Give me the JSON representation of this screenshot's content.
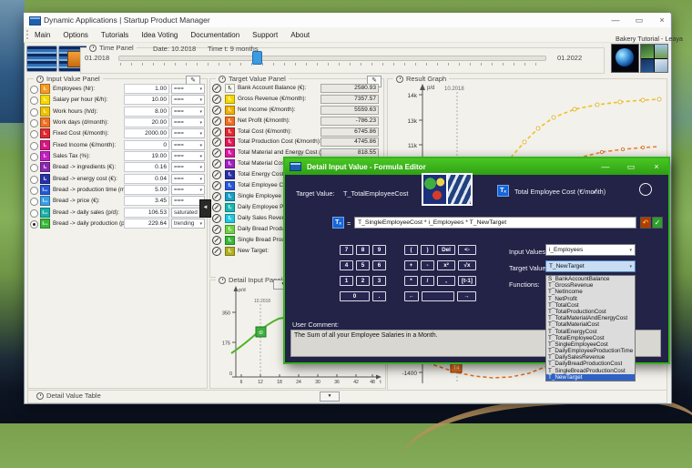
{
  "icons": {
    "minimize": "—",
    "maximize": "▭",
    "close": "×",
    "collapse": "▼",
    "splitter": "◄",
    "chevron": "▾",
    "check": "✓",
    "undo": "↶",
    "edit": "✎",
    "dlg_min": "—",
    "dlg_max": "▭",
    "dlg_close": "×"
  },
  "window": {
    "title": "Dynamic Applications | Startup Product Manager",
    "menu": [
      "Main",
      "Options",
      "Tutorials",
      "Idea Voting",
      "Documentation",
      "Support",
      "About"
    ],
    "session": "Bakery Tutorial - Leaya"
  },
  "time_panel": {
    "title": "Time Panel",
    "date_label": "Date:  10.2018",
    "time_label": "Time t:   9 months",
    "range_start": "01.2018",
    "range_end": "01.2022"
  },
  "input_panel": {
    "title": "Input Value Panel",
    "rows": [
      {
        "id": "I₁",
        "label": "Employees (Nr):",
        "value": "1.00",
        "mode": "===",
        "color": "#f59a23"
      },
      {
        "id": "I₂",
        "label": "Salary per hour (€/h):",
        "value": "10.00",
        "mode": "===",
        "color": "#f5d800"
      },
      {
        "id": "I₃",
        "label": "Work hours (h/d):",
        "value": "8.00",
        "mode": "===",
        "color": "#eec200"
      },
      {
        "id": "I₄",
        "label": "Work days (d/month):",
        "value": "20.00",
        "mode": "===",
        "color": "#f07020"
      },
      {
        "id": "I₅",
        "label": "Fixed Cost (€/month):",
        "value": "2000.00",
        "mode": "===",
        "color": "#e02830"
      },
      {
        "id": "I₆",
        "label": "Fixed Income (€/month):",
        "value": "0",
        "mode": "===",
        "color": "#d81880"
      },
      {
        "id": "I₇",
        "label": "Sales Tax (%):",
        "value": "19.00",
        "mode": "===",
        "color": "#c020c0"
      },
      {
        "id": "I₈",
        "label": "Bread -> ingredients (€):",
        "value": "0.16",
        "mode": "===",
        "color": "#8828b0"
      },
      {
        "id": "I₉",
        "label": "Bread -> energy cost (€):",
        "value": "0.04",
        "mode": "===",
        "color": "#2830a8"
      },
      {
        "id": "I₁₀",
        "label": "Bread -> production time (min/p):",
        "value": "5.00",
        "mode": "===",
        "color": "#2858d8"
      },
      {
        "id": "I₁₁",
        "label": "Bread -> price (€):",
        "value": "3.45",
        "mode": "===",
        "color": "#38a0e8"
      },
      {
        "id": "I₁₂",
        "label": "Bread -> daily sales (p/d):",
        "value": "106.53",
        "mode": "saturated",
        "color": "#18b0a8",
        "selected": false
      },
      {
        "id": "I₁₃",
        "label": "Bread -> daily production (p/d):",
        "value": "229.64",
        "mode": "trending",
        "color": "#38b838",
        "selected": true
      }
    ]
  },
  "target_panel": {
    "title": "Target Value Panel",
    "rows": [
      {
        "id": "fₓ",
        "label": "Bank Account Balance (€):",
        "value": "2580.93",
        "color": "#f7f7f2"
      },
      {
        "id": "fₓ",
        "label": "Gross Revenue (€/month):",
        "value": "7357.57",
        "color": "#f5d800"
      },
      {
        "id": "fₓ",
        "label": "Net Income (€/month):",
        "value": "5559.63",
        "color": "#f0b000"
      },
      {
        "id": "fₓ",
        "label": "Net Profit (€/month):",
        "value": "-786.23",
        "color": "#f07020"
      },
      {
        "id": "fₓ",
        "label": "Total Cost (€/month):",
        "value": "6745.86",
        "color": "#e02830"
      },
      {
        "id": "fₓ",
        "label": "Total Production Cost (€/month):",
        "value": "4745.86",
        "color": "#e01858"
      },
      {
        "id": "fₓ",
        "label": "Total Material and Energy Cost (€/month):",
        "value": "818.55",
        "color": "#d818a0"
      },
      {
        "id": "fₓ",
        "label": "Total Material Cost (€/month):",
        "value": "",
        "color": "#a020c0"
      },
      {
        "id": "fₓ",
        "label": "Total Energy Cost (€/month):",
        "value": "",
        "color": "#2830a8"
      },
      {
        "id": "fₓ",
        "label": "Total Employee Cost (€/month):",
        "value": "",
        "color": "#2858d8"
      },
      {
        "id": "fₓ",
        "label": "Single Employee Cost (€/month):",
        "value": "",
        "color": "#18a0c8"
      },
      {
        "id": "fₓ",
        "label": "Daily Employee Production Time (h/day):",
        "value": "",
        "color": "#18b8b0"
      },
      {
        "id": "fₓ",
        "label": "Daily Sales Revenue (€/day):",
        "value": "",
        "color": "#20c8e0"
      },
      {
        "id": "fₓ",
        "label": "Daily Bread Production Cost (€/day):",
        "value": "",
        "color": "#70d048"
      },
      {
        "id": "fₓ",
        "label": "Single Bread Production Cost (€):",
        "value": "",
        "color": "#38b838"
      },
      {
        "id": "fₓ",
        "label": "New Target:",
        "value": "",
        "color": "#b0b020"
      }
    ]
  },
  "result_graph": {
    "title": "Result Graph",
    "ylabel": "p/d",
    "time_marker": "10.2018",
    "ytick_14k": "14k",
    "ytick_13k": "13k",
    "ytick_11k": "11k",
    "ytick_neg": "-1400",
    "marker": "T4"
  },
  "detail_panel": {
    "title": "Detail Input Panel",
    "ylabel": "p/d",
    "time_marker": "10.2018",
    "y350": "350",
    "y175": "175",
    "y0": "0",
    "xticks": [
      "6",
      "12",
      "18",
      "24",
      "30",
      "36",
      "42",
      "48"
    ],
    "xlabel": "t",
    "marker": "t0"
  },
  "detail_table": {
    "title": "Detail Value Table"
  },
  "dialog": {
    "title": "Detail Input Value - Formula Editor",
    "target_value_label": "Target Value:",
    "target_value": "T_TotalEmployeeCost",
    "ticon": "Tₓ",
    "target_name": "Total Employee Cost (€/month)",
    "equals": "=",
    "formula": "T_SingleEmployeeCost * i_Employees * T_NewTarget",
    "keys_left": [
      "7",
      "8",
      "9",
      "4",
      "5",
      "6",
      "1",
      "2",
      "3",
      "0",
      "."
    ],
    "keys_right": [
      "(",
      ")",
      "Del",
      "<-",
      "+",
      "-",
      "x²",
      "√x",
      "*",
      "/",
      ",",
      "[t-1]",
      "←",
      "",
      "→"
    ],
    "input_values_label": "Input Values:",
    "input_values_value": "i_Employees",
    "target_values_label": "Target Values:",
    "target_values_value": "T_NewTarget",
    "functions_label": "Functions:",
    "dropdown_items": [
      "S_BankAccountBalance",
      "T_GrossRevenue",
      "T_NetIncome",
      "T_NetProfit",
      "T_TotalCost",
      "T_TotalProductionCost",
      "T_TotalMaterialAndEnergyCost",
      "T_TotalMaterialCost",
      "T_TotalEnergyCost",
      "T_TotalEmployeeCost",
      "T_SingleEmployeeCost",
      "T_DailyEmployeeProductionTime",
      "T_DailySalesRevenue",
      "T_DailyBreadProductionCost",
      "T_SingleBreadProductionCost",
      "T_NewTarget"
    ],
    "user_comment_label": "User Comment:",
    "user_comment": "The Sum of all your Employee Salaries in a Month."
  },
  "chart_data": [
    {
      "type": "line",
      "title": "Result Graph",
      "ylabel": "p/d",
      "yticks": [
        "14k",
        "13k",
        "11k",
        "-1400"
      ],
      "time_marker": "10.2018",
      "series": [
        {
          "name": "saturating-yellow",
          "approx_x_months": [
            14,
            18,
            22,
            26,
            30,
            34,
            38,
            42,
            46
          ],
          "approx_y": [
            10800,
            11800,
            12600,
            13100,
            13500,
            13700,
            13850,
            13950,
            14000
          ]
        },
        {
          "name": "rising-orange",
          "approx_x_months": [
            26,
            30,
            34,
            38,
            42,
            46
          ],
          "approx_y": [
            10700,
            10850,
            10950,
            11000,
            11050,
            11100
          ]
        },
        {
          "name": "net-profit-orange",
          "approx_x_months": [
            2,
            6,
            10,
            14,
            18,
            22,
            26
          ],
          "approx_y": [
            -1200,
            -1320,
            -1400,
            -1420,
            -1380,
            -1280,
            -1150
          ],
          "marker_label": "T4"
        }
      ]
    },
    {
      "type": "line",
      "title": "Detail Input Panel",
      "ylabel": "p/d",
      "yticks": [
        0,
        175,
        350
      ],
      "xticks": [
        6,
        12,
        18,
        24,
        30,
        36,
        42,
        48
      ],
      "time_marker": "10.2018",
      "series": [
        {
          "name": "Bread -> daily production (trending)",
          "approx_x_months": [
            1,
            3,
            6,
            9,
            12,
            16,
            20,
            26
          ],
          "approx_y": [
            120,
            140,
            170,
            230,
            260,
            280,
            290,
            295
          ],
          "marker_label": "t0"
        }
      ]
    }
  ]
}
